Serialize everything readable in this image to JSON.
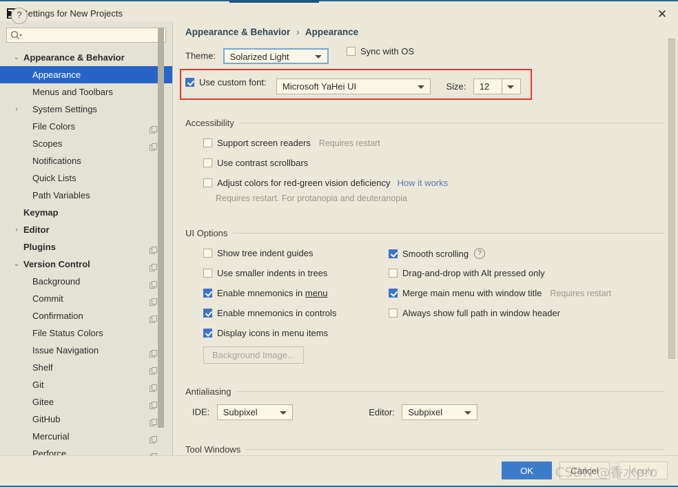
{
  "window": {
    "title": "Settings for New Projects",
    "app_icon": "intellij-idea-icon",
    "close_label": "✕"
  },
  "sidebar": {
    "search": {
      "placeholder": "",
      "value": "",
      "icon": "search-icon"
    },
    "items": [
      {
        "label": "Appearance & Behavior",
        "indent": 0,
        "bold": true,
        "arrow": "⌄",
        "expanded": true,
        "selected": false,
        "copy": false
      },
      {
        "label": "Appearance",
        "indent": 1,
        "bold": false,
        "arrow": "",
        "expanded": false,
        "selected": true,
        "copy": false
      },
      {
        "label": "Menus and Toolbars",
        "indent": 1,
        "bold": false,
        "arrow": "",
        "expanded": false,
        "selected": false,
        "copy": false
      },
      {
        "label": "System Settings",
        "indent": 1,
        "bold": false,
        "arrow": "›",
        "expanded": false,
        "selected": false,
        "copy": false
      },
      {
        "label": "File Colors",
        "indent": 1,
        "bold": false,
        "arrow": "",
        "expanded": false,
        "selected": false,
        "copy": true
      },
      {
        "label": "Scopes",
        "indent": 1,
        "bold": false,
        "arrow": "",
        "expanded": false,
        "selected": false,
        "copy": true
      },
      {
        "label": "Notifications",
        "indent": 1,
        "bold": false,
        "arrow": "",
        "expanded": false,
        "selected": false,
        "copy": false
      },
      {
        "label": "Quick Lists",
        "indent": 1,
        "bold": false,
        "arrow": "",
        "expanded": false,
        "selected": false,
        "copy": false
      },
      {
        "label": "Path Variables",
        "indent": 1,
        "bold": false,
        "arrow": "",
        "expanded": false,
        "selected": false,
        "copy": false
      },
      {
        "label": "Keymap",
        "indent": 0,
        "bold": true,
        "arrow": "",
        "expanded": false,
        "selected": false,
        "copy": false
      },
      {
        "label": "Editor",
        "indent": 0,
        "bold": true,
        "arrow": "›",
        "expanded": false,
        "selected": false,
        "copy": false
      },
      {
        "label": "Plugins",
        "indent": 0,
        "bold": true,
        "arrow": "",
        "expanded": false,
        "selected": false,
        "copy": true
      },
      {
        "label": "Version Control",
        "indent": 0,
        "bold": true,
        "arrow": "⌄",
        "expanded": true,
        "selected": false,
        "copy": true
      },
      {
        "label": "Background",
        "indent": 1,
        "bold": false,
        "arrow": "",
        "expanded": false,
        "selected": false,
        "copy": true
      },
      {
        "label": "Commit",
        "indent": 1,
        "bold": false,
        "arrow": "",
        "expanded": false,
        "selected": false,
        "copy": true
      },
      {
        "label": "Confirmation",
        "indent": 1,
        "bold": false,
        "arrow": "",
        "expanded": false,
        "selected": false,
        "copy": true
      },
      {
        "label": "File Status Colors",
        "indent": 1,
        "bold": false,
        "arrow": "",
        "expanded": false,
        "selected": false,
        "copy": false
      },
      {
        "label": "Issue Navigation",
        "indent": 1,
        "bold": false,
        "arrow": "",
        "expanded": false,
        "selected": false,
        "copy": true
      },
      {
        "label": "Shelf",
        "indent": 1,
        "bold": false,
        "arrow": "",
        "expanded": false,
        "selected": false,
        "copy": true
      },
      {
        "label": "Git",
        "indent": 1,
        "bold": false,
        "arrow": "",
        "expanded": false,
        "selected": false,
        "copy": true
      },
      {
        "label": "Gitee",
        "indent": 1,
        "bold": false,
        "arrow": "",
        "expanded": false,
        "selected": false,
        "copy": true
      },
      {
        "label": "GitHub",
        "indent": 1,
        "bold": false,
        "arrow": "",
        "expanded": false,
        "selected": false,
        "copy": true
      },
      {
        "label": "Mercurial",
        "indent": 1,
        "bold": false,
        "arrow": "",
        "expanded": false,
        "selected": false,
        "copy": true
      },
      {
        "label": "Perforce",
        "indent": 1,
        "bold": false,
        "arrow": "",
        "expanded": false,
        "selected": false,
        "copy": true
      }
    ]
  },
  "breadcrumb": {
    "root": "Appearance & Behavior",
    "separator": "›",
    "current": "Appearance"
  },
  "theme_row": {
    "label": "Theme:",
    "value": "Solarized Light",
    "sync_with_os": {
      "label": "Sync with OS",
      "checked": false
    }
  },
  "font_row": {
    "use_custom_font": {
      "label": "Use custom font:",
      "checked": true
    },
    "font_value": "Microsoft YaHei UI",
    "size_label": "Size:",
    "size_value": "12",
    "highlight_color": "#e8352a"
  },
  "accessibility": {
    "title": "Accessibility",
    "options": [
      {
        "label": "Support screen readers",
        "checked": false,
        "hint": "Requires restart",
        "link": ""
      },
      {
        "label": "Use contrast scrollbars",
        "checked": false,
        "hint": "",
        "link": ""
      },
      {
        "label": "Adjust colors for red-green vision deficiency",
        "checked": false,
        "hint": "",
        "link": "How it works"
      }
    ],
    "note": "Requires restart. For protanopia and deuteranopia"
  },
  "ui_options": {
    "title": "UI Options",
    "left": [
      {
        "label": "Show tree indent guides",
        "checked": false
      },
      {
        "label": "Use smaller indents in trees",
        "checked": false
      },
      {
        "label": "Enable mnemonics in menu",
        "checked": true,
        "mnemonic": "menu"
      },
      {
        "label": "Enable mnemonics in controls",
        "checked": true
      },
      {
        "label": "Display icons in menu items",
        "checked": true
      }
    ],
    "right": [
      {
        "label": "Smooth scrolling",
        "checked": true,
        "help": "?",
        "hint": ""
      },
      {
        "label": "Drag-and-drop with Alt pressed only",
        "checked": false,
        "hint": ""
      },
      {
        "label": "Merge main menu with window title",
        "checked": true,
        "hint": "Requires restart"
      },
      {
        "label": "Always show full path in window header",
        "checked": false,
        "hint": ""
      }
    ],
    "background_image_button": "Background Image..."
  },
  "antialiasing": {
    "title": "Antialiasing",
    "ide_label": "IDE:",
    "ide_value": "Subpixel",
    "editor_label": "Editor:",
    "editor_value": "Subpixel"
  },
  "tool_windows": {
    "title": "Tool Windows"
  },
  "footer": {
    "help": "?",
    "ok": "OK",
    "cancel": "Cancel",
    "apply": "Apply",
    "watermark": "CSDN @香水pro"
  }
}
